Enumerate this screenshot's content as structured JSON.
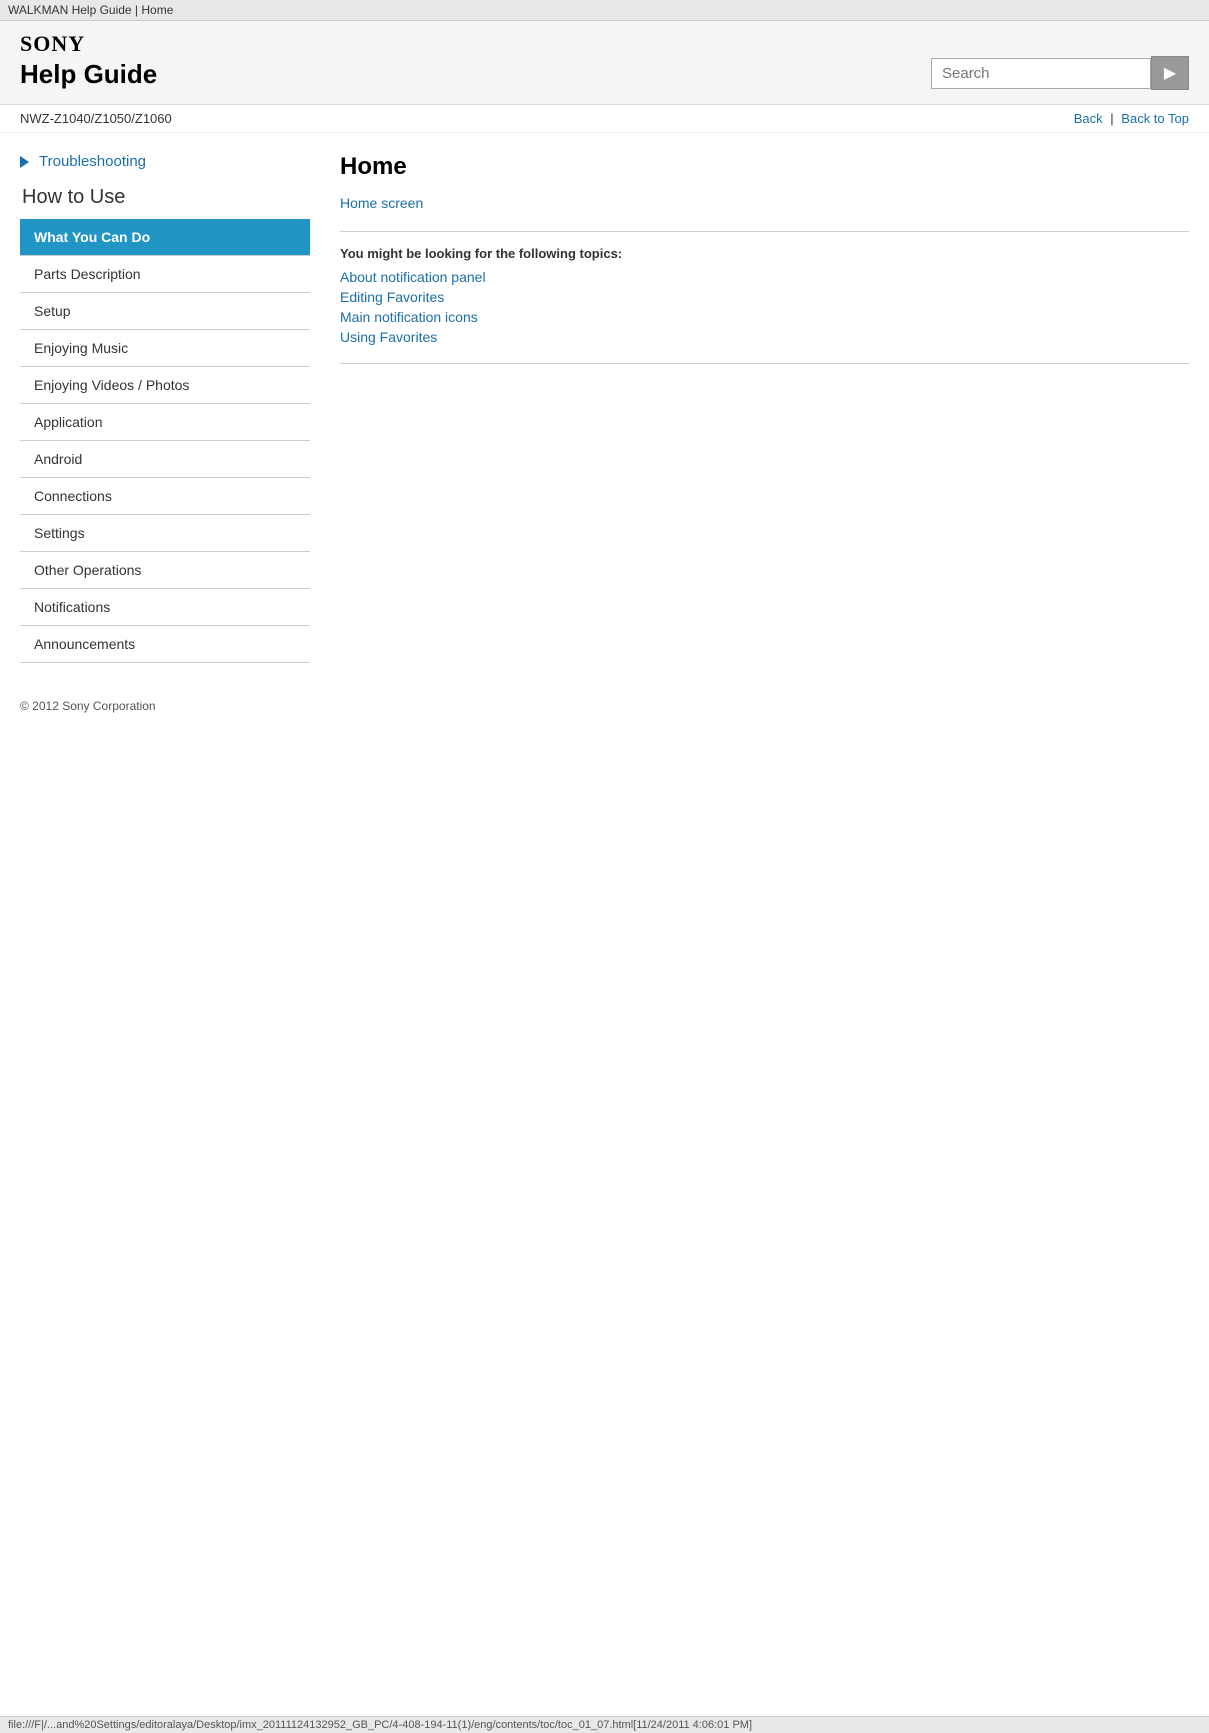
{
  "browser": {
    "title": "WALKMAN Help Guide | Home",
    "bottom_bar": "file:///F|/...and%20Settings/editoralaya/Desktop/imx_20111124132952_GB_PC/4-408-194-11(1)/eng/contents/toc/toc_01_07.html[11/24/2011 4:06:01 PM]"
  },
  "header": {
    "sony_logo": "SONY",
    "help_guide": "Help Guide",
    "search_placeholder": "Search",
    "search_button_icon": "🔍"
  },
  "subheader": {
    "model_number": "NWZ-Z1040/Z1050/Z1060",
    "back_label": "Back",
    "back_to_top_label": "Back to Top"
  },
  "sidebar": {
    "troubleshooting_label": "Troubleshooting",
    "how_to_use_label": "How to Use",
    "items": [
      {
        "label": "What You Can Do",
        "active": true
      },
      {
        "label": "Parts Description",
        "active": false
      },
      {
        "label": "Setup",
        "active": false
      },
      {
        "label": "Enjoying Music",
        "active": false
      },
      {
        "label": "Enjoying Videos / Photos",
        "active": false
      },
      {
        "label": "Application",
        "active": false
      },
      {
        "label": "Android",
        "active": false
      },
      {
        "label": "Connections",
        "active": false
      },
      {
        "label": "Settings",
        "active": false
      },
      {
        "label": "Other Operations",
        "active": false
      },
      {
        "label": "Notifications",
        "active": false
      },
      {
        "label": "Announcements",
        "active": false
      }
    ]
  },
  "content": {
    "page_title": "Home",
    "home_screen_link": "Home screen",
    "related_topics_label": "You might be looking for the following topics:",
    "topic_links": [
      "About notification panel",
      "Editing Favorites",
      "Main notification icons",
      "Using Favorites"
    ]
  },
  "footer": {
    "copyright": "© 2012 Sony Corporation"
  }
}
